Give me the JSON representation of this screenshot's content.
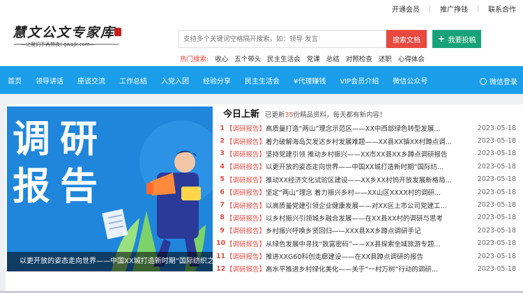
{
  "top_links": [
    "开通会员",
    "推广挣钱",
    "联系合作"
  ],
  "logo": {
    "text": "慧文公文专家库",
    "tagline": "—让我们不再熬夜! gwajk.com—"
  },
  "search": {
    "placeholder": "支持多个关键词空格隔开搜索，如：领导 发言",
    "button": "搜索文档"
  },
  "post_button": {
    "icon": "plus-icon",
    "label": "我要投稿"
  },
  "hot": {
    "label": "热门搜索:",
    "items": [
      "收心",
      "五个带头",
      "民主生活会",
      "党课",
      "总结",
      "对照检查",
      "述职",
      "心得体会"
    ]
  },
  "nav": {
    "items": [
      "首页",
      "领导讲话",
      "座谈交流",
      "工作总结",
      "入党入团",
      "经验分享",
      "民主生活会",
      "¥代理赚钱",
      "VIP会员介绍",
      "微信公众号"
    ],
    "wechat_login": "微信登录",
    "wechat_icon": "wechat-icon"
  },
  "banner": {
    "big_text": "调研报告",
    "caption": "以更开放的姿态走向世界——中国XX城打造新时期“国际纺织之都..."
  },
  "feed": {
    "title": "今日上新",
    "sub_prefix": "已更新",
    "sub_count": "35",
    "sub_suffix": "份精品资料，每天都有新内容！",
    "rows": [
      {
        "idx": "1",
        "tag": "【调研报告】",
        "title": "高质量打造“两山”理念示范区——XX中西部绿色转型发展...",
        "date": "2023-05-18"
      },
      {
        "idx": "2",
        "tag": "【调研报告】",
        "title": "着力破解海岛欠发达乡村发展难题——XX县XX镇XX村蹲点调...",
        "date": "2023-05-18"
      },
      {
        "idx": "3",
        "tag": "【调研报告】",
        "title": "坚持党建引领 推动乡村振兴——XX市XX县XX乡蹲点调研报告",
        "date": "2023-05-18"
      },
      {
        "idx": "4",
        "tag": "【调研报告】",
        "title": "以更开放的姿态走向世界——中国XX城打造新时期“国际纺...",
        "date": "2023-05-18"
      },
      {
        "idx": "5",
        "tag": "【调研报告】",
        "title": "推动XX经济文化试验区建设——XX乡XX村钨开放发展新格局...",
        "date": "2023-05-18"
      },
      {
        "idx": "6",
        "tag": "【调研报告】",
        "title": "坚定“两山”理念 着力振兴乡村——XX山区XXXX村的调研...",
        "date": "2023-05-18"
      },
      {
        "idx": "7",
        "tag": "【调研报告】",
        "title": "以高质量党建引领企业健康发展——对XX区上市公司党建工...",
        "date": "2023-05-18"
      },
      {
        "idx": "8",
        "tag": "【调研报告】",
        "title": "以乡村振兴引领城乡融合发展——在XX县XX村的调研与思考",
        "date": "2023-05-18"
      },
      {
        "idx": "9",
        "tag": "【调研报告】",
        "title": "乡村振兴呼唤乡贤回归——XXX县XX乡蹲点调研手记",
        "date": "2023-05-18"
      },
      {
        "idx": "10",
        "tag": "【调研报告】",
        "title": "从绿色发展中寻找“致富密码”——XX县探索全域旅游专题...",
        "date": "2023-05-18"
      },
      {
        "idx": "11",
        "tag": "【调研报告】",
        "title": "推进XXG60科创走廊建设——在XX县蹲点调研的报告",
        "date": "2023-05-18"
      },
      {
        "idx": "12",
        "tag": "【调研报告】",
        "title": "高水平推进乡村绿化美化——关于“一村万树”行动的调研...",
        "date": "2023-05-18"
      }
    ]
  },
  "colors": {
    "nav_blue": "#1a9ee9",
    "accent_red": "#e8493f",
    "post_green": "#18a27a"
  }
}
